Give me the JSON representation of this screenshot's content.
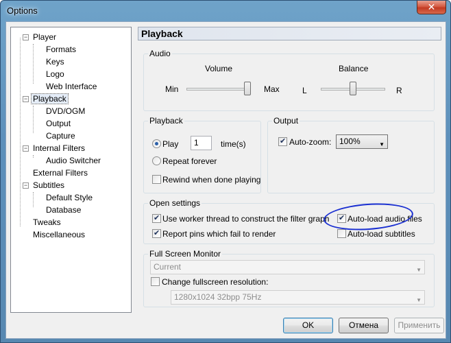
{
  "window": {
    "title": "Options",
    "close_glyph": "✕"
  },
  "tree": {
    "items": [
      {
        "label": "Player",
        "level": 0,
        "expander": "−"
      },
      {
        "label": "Formats",
        "level": 1
      },
      {
        "label": "Keys",
        "level": 1
      },
      {
        "label": "Logo",
        "level": 1
      },
      {
        "label": "Web Interface",
        "level": 1
      },
      {
        "label": "Playback",
        "level": 0,
        "expander": "−",
        "selected": true
      },
      {
        "label": "DVD/OGM",
        "level": 1
      },
      {
        "label": "Output",
        "level": 1
      },
      {
        "label": "Capture",
        "level": 1
      },
      {
        "label": "Internal Filters",
        "level": 0,
        "expander": "−"
      },
      {
        "label": "Audio Switcher",
        "level": 1
      },
      {
        "label": "External Filters",
        "level": 0
      },
      {
        "label": "Subtitles",
        "level": 0,
        "expander": "−"
      },
      {
        "label": "Default Style",
        "level": 1
      },
      {
        "label": "Database",
        "level": 1
      },
      {
        "label": "Tweaks",
        "level": 0
      },
      {
        "label": "Miscellaneous",
        "level": 0
      }
    ]
  },
  "page": {
    "header": "Playback",
    "audio": {
      "title": "Audio",
      "volume_label": "Volume",
      "volume_min": "Min",
      "volume_max": "Max",
      "volume_level": 1.0,
      "balance_label": "Balance",
      "balance_l": "L",
      "balance_r": "R",
      "balance_level": 0.5
    },
    "playback": {
      "title": "Playback",
      "play_label": "Play",
      "play_value": "1",
      "times_label": "time(s)",
      "play_checked": true,
      "repeat_label": "Repeat forever",
      "repeat_checked": false,
      "rewind_label": "Rewind when done playing",
      "rewind_checked": false
    },
    "output": {
      "title": "Output",
      "autozoom_label": "Auto-zoom:",
      "autozoom_checked": true,
      "autozoom_value": "100%"
    },
    "open_settings": {
      "title": "Open settings",
      "worker_label": "Use worker thread to construct the filter graph",
      "worker_checked": true,
      "report_label": "Report pins which fail to render",
      "report_checked": true,
      "audio_label": "Auto-load audio files",
      "audio_checked": true,
      "subs_label": "Auto-load subtitles",
      "subs_checked": false
    },
    "fullscreen": {
      "title": "Full Screen Monitor",
      "monitor_value": "Current",
      "change_label": "Change fullscreen resolution:",
      "change_checked": false,
      "resolution_value": "1280x1024 32bpp 75Hz"
    }
  },
  "buttons": {
    "ok": "OK",
    "cancel": "Отмена",
    "apply": "Применить"
  },
  "icons": {
    "expander": "box-minus",
    "dropdown": "▼"
  },
  "colors": {
    "annotation": "#1a2fd1",
    "selected_bg": "#e4ecf7"
  }
}
